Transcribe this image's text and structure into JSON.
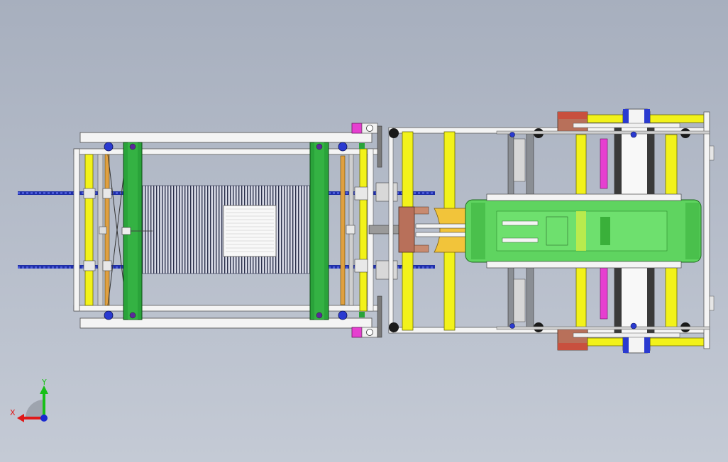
{
  "triad": {
    "x_label": "X",
    "y_label": "Y"
  },
  "colors": {
    "background_top": "#a7afbe",
    "background_bottom": "#c4cad5",
    "frame_white": "#f4f4f4",
    "frame_stroke": "#5a5a5a",
    "rail_yellow": "#f2f21a",
    "beam_green": "#2aa33a",
    "conveyor_green": "#5fd460",
    "chain_blue": "#1f2fa8",
    "bracket_magenta": "#e63fd0",
    "block_orange": "#f2c43a",
    "block_brown": "#b8705a",
    "block_red": "#c8503e",
    "rod_gray": "#8a8e94",
    "wheel_black": "#1a1a1a",
    "axis_x": "#e01818",
    "axis_y": "#18c018",
    "axis_z": "#1a2ad0"
  },
  "icons": [
    "coordinate-triad-icon"
  ]
}
